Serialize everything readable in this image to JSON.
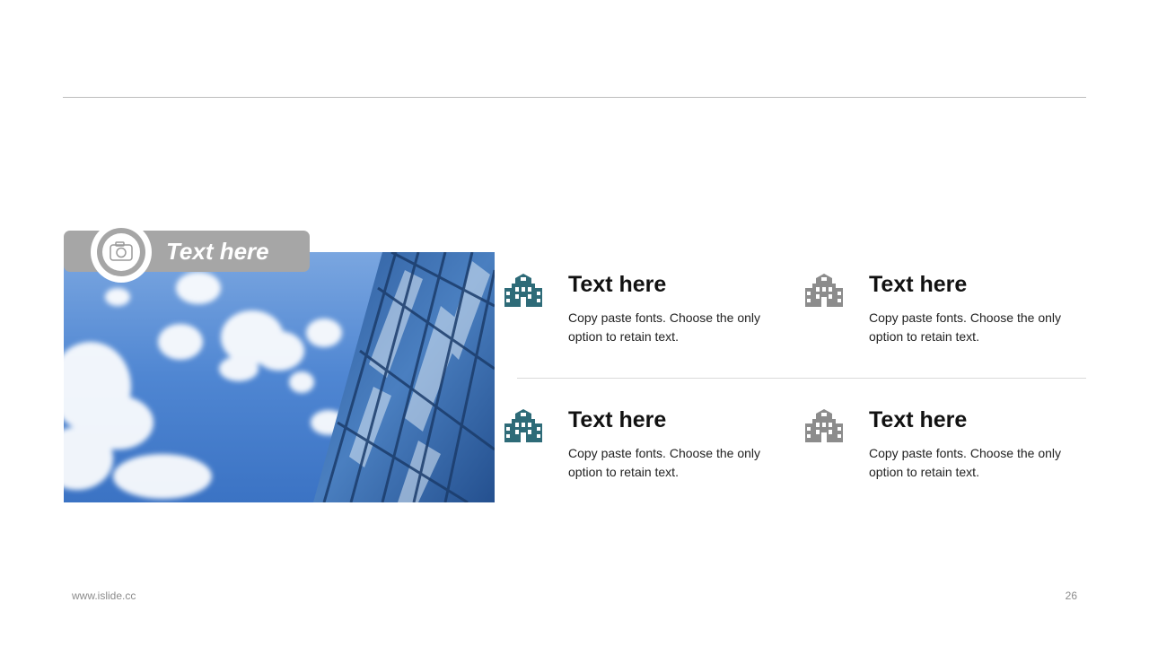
{
  "photo_card": {
    "label": "Text here",
    "icon": "camera-icon"
  },
  "items": [
    {
      "title": "Text here",
      "desc": "Copy paste fonts. Choose the only option to retain text.",
      "icon": "building-icon",
      "color": "#2e6b78"
    },
    {
      "title": "Text here",
      "desc": "Copy paste fonts. Choose the only option to retain text.",
      "icon": "building-icon",
      "color": "#8c8c8c"
    },
    {
      "title": "Text here",
      "desc": "Copy paste fonts. Choose the only option to retain text.",
      "icon": "building-icon",
      "color": "#2e6b78"
    },
    {
      "title": "Text here",
      "desc": "Copy paste fonts. Choose the only option to retain text.",
      "icon": "building-icon",
      "color": "#8c8c8c"
    }
  ],
  "footer": {
    "url": "www.islide.cc",
    "page_number": "26"
  }
}
